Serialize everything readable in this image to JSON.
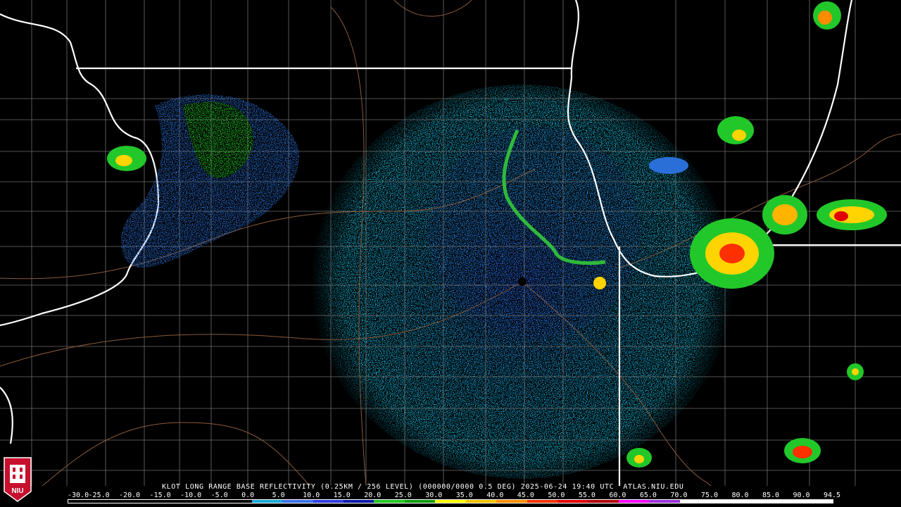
{
  "caption": "KLOT LONG RANGE BASE REFLECTIVITY (0.25KM / 256 LEVEL) (000000/0000 0.5 DEG) 2025-06-24 19:40 UTC  ATLAS.NIU.EDU",
  "scale": {
    "labels": [
      "-30.0",
      "-25.0",
      "-20.0",
      "-15.0",
      "-10.0",
      "-5.0",
      "0.0",
      "5.0",
      "10.0",
      "15.0",
      "20.0",
      "25.0",
      "30.0",
      "35.0",
      "40.0",
      "45.0",
      "50.0",
      "55.0",
      "60.0",
      "65.0",
      "70.0",
      "75.0",
      "80.0",
      "85.0",
      "90.0",
      "94.5"
    ],
    "colors": [
      "#000000",
      "#000000",
      "#000000",
      "#000000",
      "#000000",
      "#000000",
      "#17a6d8",
      "#3b70e8",
      "#2f3be0",
      "#0a18a8",
      "#1ec81e",
      "#0d9c0d",
      "#ffff00",
      "#f0c000",
      "#ff8c00",
      "#ff3000",
      "#e00000",
      "#b00000",
      "#ff00ff",
      "#9b30d8",
      "#ffffff",
      "#ffffff",
      "#ffffff",
      "#ffffff",
      "#ffffff"
    ]
  },
  "logo": {
    "text": "NIU",
    "color": "#c8102e"
  },
  "radar_site": "KLOT"
}
